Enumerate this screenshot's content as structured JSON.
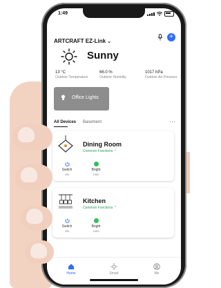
{
  "status_bar": {
    "time": "1:49"
  },
  "header": {
    "home_name": "ARTCRAFT EZ-Link",
    "add_label": "+"
  },
  "weather": {
    "condition": "Sunny",
    "metrics": [
      {
        "value": "13 °C",
        "label": "Outdoor Temperature"
      },
      {
        "value": "66.0 %",
        "label": "Outdoor Humidity"
      },
      {
        "value": "1017 hPa",
        "label": "Outdoor Air Pressure"
      }
    ]
  },
  "scene": {
    "label": "Office Lights"
  },
  "tabs": {
    "all": "All Devices",
    "basement": "Basement",
    "more": "···"
  },
  "devices": [
    {
      "name": "Dining Room",
      "subtitle": "Common Functions ⌃",
      "switch_label": "Switch",
      "switch_value": "ON",
      "bright_label": "Bright",
      "bright_value": "1000"
    },
    {
      "name": "Kitchen",
      "subtitle": "Common Functions ⌃",
      "switch_label": "Switch",
      "switch_value": "ON",
      "bright_label": "Bright",
      "bright_value": "1000"
    }
  ],
  "bottom_nav": {
    "home": "Home",
    "smart": "Smart",
    "me": "Me"
  },
  "colors": {
    "accent": "#2f6dff",
    "scene_bg": "#8d8d8d",
    "green": "#2fbf5b"
  }
}
